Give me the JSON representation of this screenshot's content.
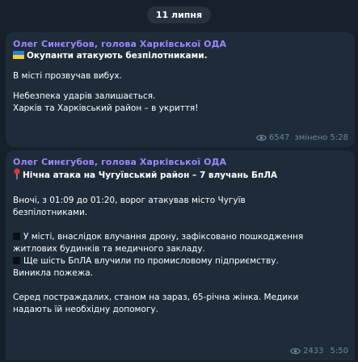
{
  "date_label": "11 липня",
  "messages": [
    {
      "author": "Олег Синєгубов, голова Харківської ОДА",
      "title": "Окупанти атакують безпілотниками.",
      "lines": [
        "В місті прозвучав вибух.",
        "Небезпека ударів залишається.",
        "Харків та Харківський район – в укриття!"
      ],
      "views": "6547",
      "edited_time": "змінено 5:28"
    },
    {
      "author": "Олег Синєгубов, голова Харківської ОДА",
      "title": "Нічна атака на Чугуївський район – 7 влучань БпЛА",
      "lines": [
        "Вночі, з 01:09 до 01:20, ворог атакував місто Чугуїв",
        "безпілотниками.",
        "У місті, внаслідок влучання дрону, зафіксовано пошкодження",
        "житлових будинків та медичного закладу.",
        "Ще шість БпЛА влучили по промисловому підприємству.",
        "Виникла пожежа.",
        "Серед постраждалих, станом на зараз, 65-річна жінка. Медики",
        "надають їй необхідну допомогу."
      ],
      "views": "2433",
      "time": "5:50"
    }
  ],
  "colors": {
    "author": "#9d87ff",
    "bubble": "#1e2c3a",
    "background": "#15202b",
    "meta": "#6f8495"
  },
  "icons": [
    "flag-icon",
    "pin-icon",
    "black-square-icon",
    "eye-icon"
  ]
}
